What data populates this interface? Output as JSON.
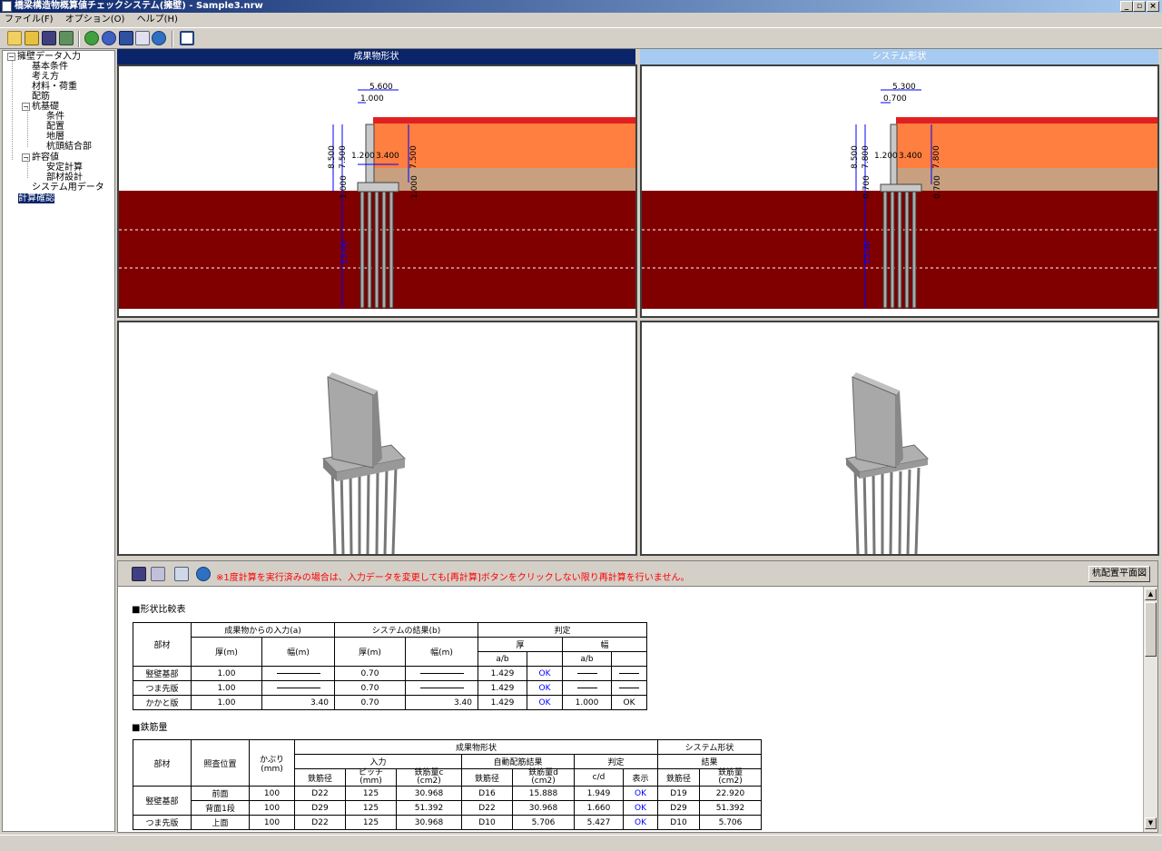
{
  "window": {
    "title": "橋梁構造物概算値チェックシステム(擁壁) - Sample3.nrw"
  },
  "menu": [
    "ファイル(F)",
    "オプション(O)",
    "ヘルプ(H)"
  ],
  "toolbar": {
    "icons": [
      "new-icon",
      "open-icon",
      "save-icon",
      "export-icon",
      "help-icon",
      "info-icon",
      "nk-logo-icon",
      "mail-icon",
      "about-icon",
      "window-icon"
    ]
  },
  "tree": {
    "root": "擁壁データ入力",
    "items": [
      "基本条件",
      "考え方",
      "材料・荷重",
      "配筋",
      "杭基礎",
      "条件",
      "配置",
      "地層",
      "杭頭結合部",
      "許容値",
      "安定計算",
      "部材設計",
      "システム用データ",
      "計算確認"
    ]
  },
  "views": {
    "left": {
      "title": "成果物形状",
      "dims": {
        "top": "5.600",
        "toe": "1.000",
        "height": "8.500",
        "wall": "7.500",
        "toe_w": "1.200",
        "heel_w": "3.400",
        "right": "7.500",
        "base": "1.000",
        "base_r": "1.000",
        "pile": "23.00"
      }
    },
    "right": {
      "title": "システム形状",
      "dims": {
        "top": "5.300",
        "toe": "0.700",
        "height": "8.500",
        "wall": "7.800",
        "toe_w": "1.200",
        "heel_w": "3.400",
        "right": "7.800",
        "base": "0.700",
        "base_r": "0.700",
        "pile": "23.00"
      }
    }
  },
  "lower": {
    "notice": "※1度計算を実行済みの場合は、入力データを変更しても[再計算]ボタンをクリックしない限り再計算を行いません。",
    "pile_button": "杭配置平面図"
  },
  "shape_table": {
    "title": "■形状比較表",
    "h": {
      "member": "部材",
      "input": "成果物からの入力(a)",
      "system": "システムの結果(b)",
      "judge": "判定",
      "thick": "厚(m)",
      "width": "幅(m)",
      "j_thick": "厚",
      "j_width": "幅",
      "ab": "a/b"
    },
    "rows": [
      {
        "name": "竪壁基部",
        "a_t": "1.00",
        "a_w": "",
        "b_t": "0.70",
        "b_w": "",
        "r_t": "1.429",
        "j_t": "OK",
        "r_w": "",
        "j_w": ""
      },
      {
        "name": "つま先版",
        "a_t": "1.00",
        "a_w": "",
        "b_t": "0.70",
        "b_w": "",
        "r_t": "1.429",
        "j_t": "OK",
        "r_w": "",
        "j_w": ""
      },
      {
        "name": "かかと版",
        "a_t": "1.00",
        "a_w": "3.40",
        "b_t": "0.70",
        "b_w": "3.40",
        "r_t": "1.429",
        "j_t": "OK",
        "r_w": "1.000",
        "j_w": "OK"
      }
    ]
  },
  "rebar_table": {
    "title": "■鉄筋量",
    "h": {
      "member": "部材",
      "pos": "照査位置",
      "cover1": "かぶり",
      "cover2": "(mm)",
      "prod": "成果物形状",
      "sys": "システム形状",
      "input": "入力",
      "auto": "自動配筋結果",
      "judge": "判定",
      "result": "結果",
      "dia": "鉄筋径",
      "pitch1": "ピッチ",
      "pitch2": "(mm)",
      "area_c1": "鉄筋量c",
      "area_c2": "(cm2)",
      "area_d1": "鉄筋量d",
      "area_d2": "(cm2)",
      "cd": "c/d",
      "disp": "表示",
      "area1": "鉄筋量",
      "area2": "(cm2)"
    },
    "rows": [
      {
        "member": "竪壁基部",
        "pos": "前面",
        "cover": "100",
        "dia": "D22",
        "pitch": "125",
        "area": "30.968",
        "adia": "D16",
        "aarea": "15.888",
        "cd": "1.949",
        "disp": "OK",
        "sdia": "D19",
        "sarea": "22.920"
      },
      {
        "member": "",
        "pos": "背面1段",
        "cover": "100",
        "dia": "D29",
        "pitch": "125",
        "area": "51.392",
        "adia": "D22",
        "aarea": "30.968",
        "cd": "1.660",
        "disp": "OK",
        "sdia": "D29",
        "sarea": "51.392"
      },
      {
        "member": "つま先版",
        "pos": "上面",
        "cover": "100",
        "dia": "D22",
        "pitch": "125",
        "area": "30.968",
        "adia": "D10",
        "aarea": "5.706",
        "cd": "5.427",
        "disp": "OK",
        "sdia": "D10",
        "sarea": "5.706"
      }
    ]
  },
  "colors": {
    "title_active": "#0a246a",
    "title_inactive": "#a6caf0",
    "soil_top": "#ff7f40",
    "soil_mid": "#c8a080",
    "soil_deep": "#800000",
    "notice": "#ff0000"
  }
}
